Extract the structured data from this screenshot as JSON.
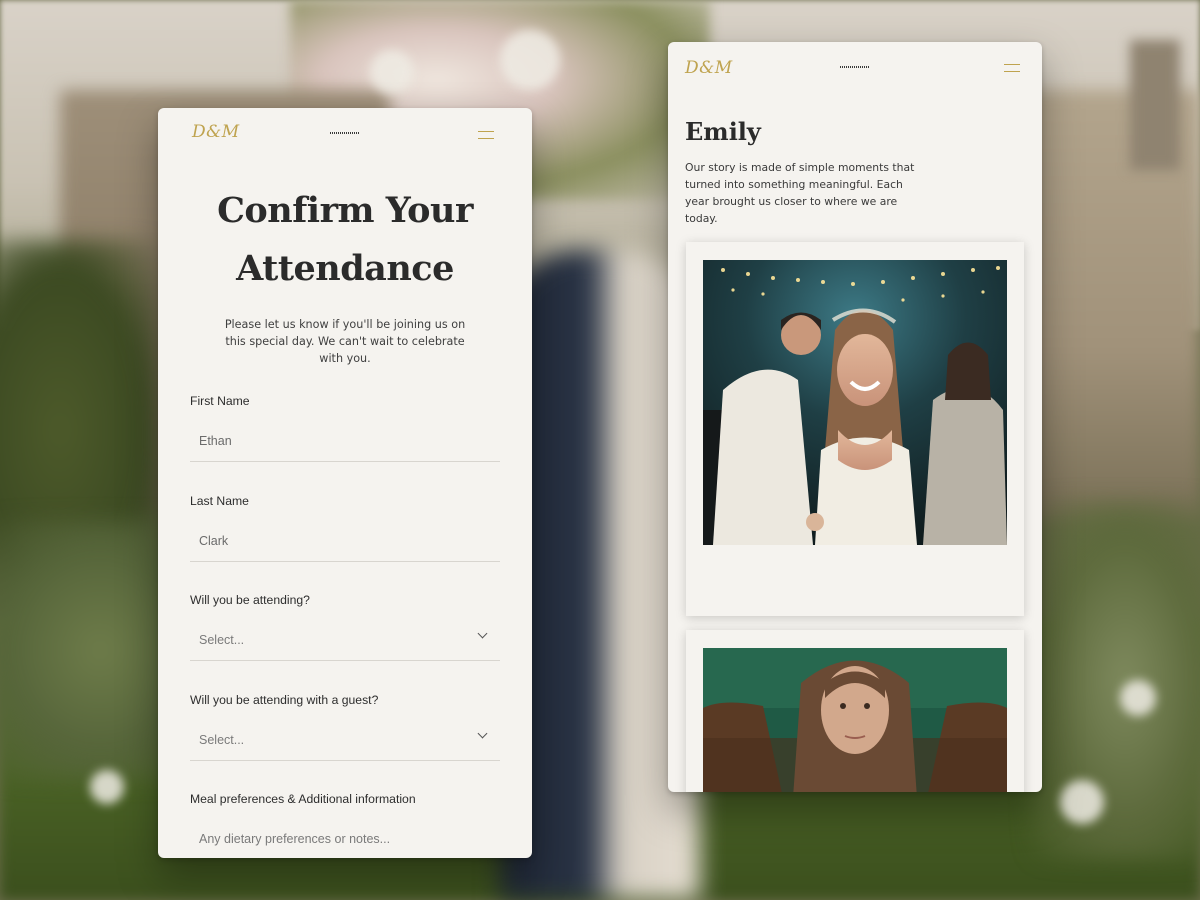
{
  "brand": {
    "logo": "D&M"
  },
  "rsvp": {
    "title_line1": "Confirm Your",
    "title_line2": "Attendance",
    "intro": "Please let us know if you'll be joining us on this special day. We can't wait to celebrate with you.",
    "fields": {
      "first_name": {
        "label": "First Name",
        "value": "Ethan"
      },
      "last_name": {
        "label": "Last Name",
        "value": "Clark"
      },
      "attending": {
        "label": "Will you be attending?",
        "placeholder": "Select..."
      },
      "guest": {
        "label": "Will you be attending with a guest?",
        "placeholder": "Select..."
      },
      "meal": {
        "label": "Meal preferences & Additional information",
        "placeholder": "Any dietary preferences or notes..."
      }
    }
  },
  "story": {
    "name": "Emily",
    "text": "Our story is made of simple moments that turned into something meaningful. Each year brought us closer to where we are today."
  },
  "icons": {
    "menu": "hamburger-icon",
    "select": "chevron-down-icon"
  },
  "colors": {
    "accent": "#bfa34f",
    "card_bg": "#f5f3ef",
    "text": "#2b2b2b"
  }
}
